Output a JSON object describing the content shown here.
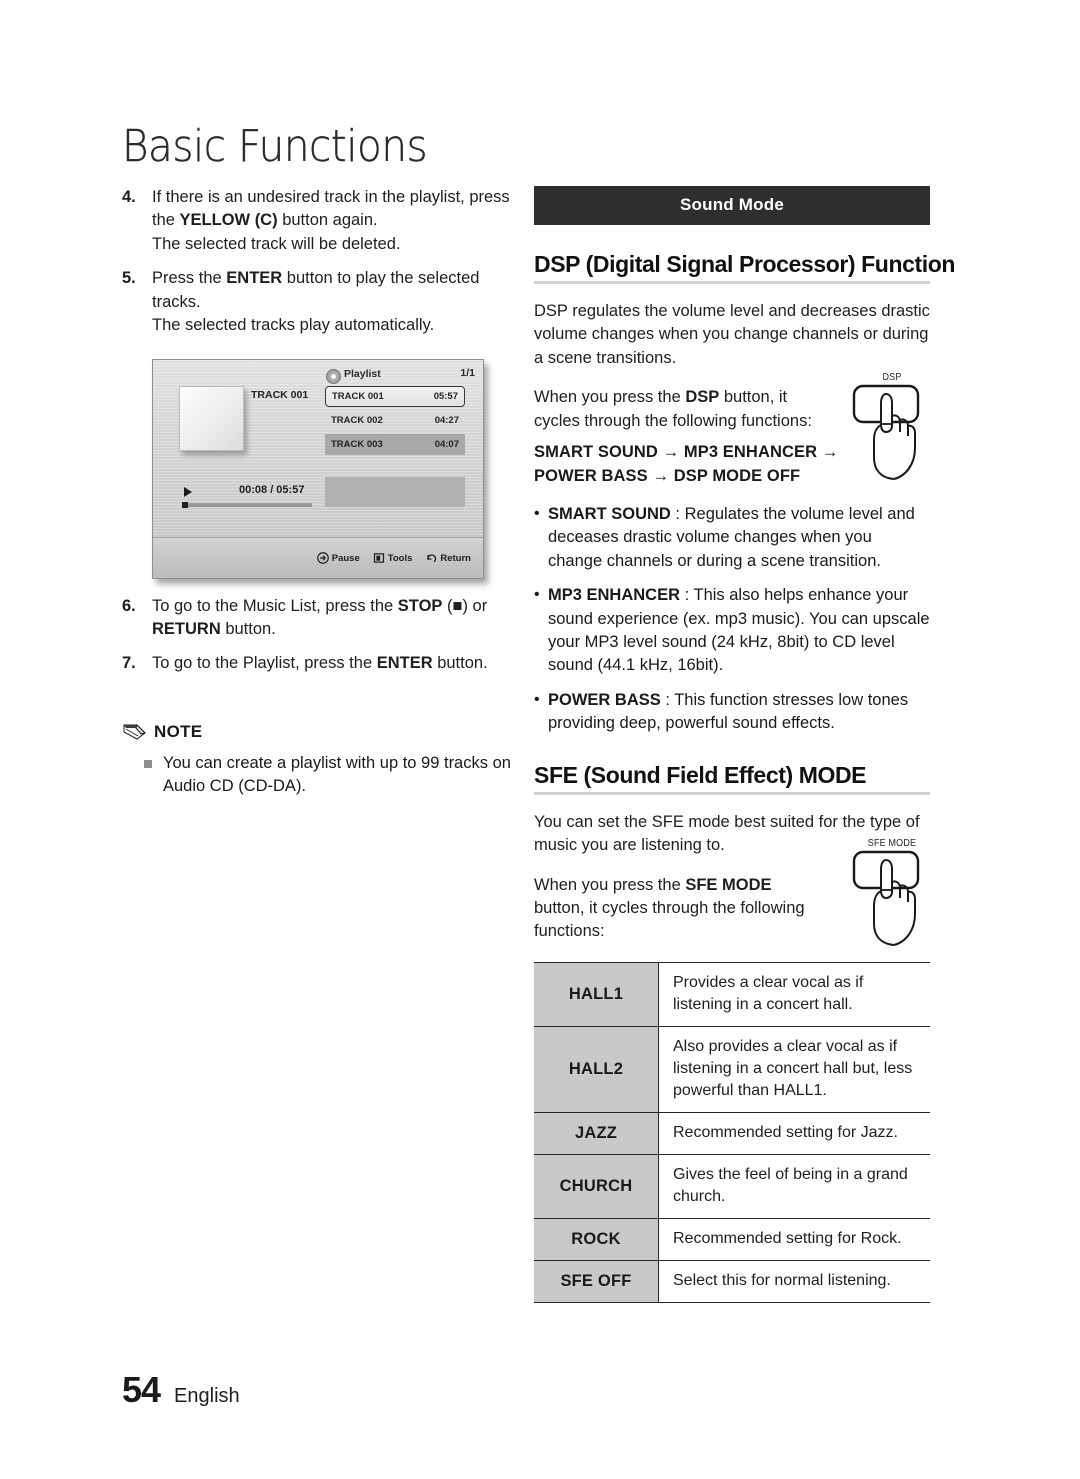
{
  "chapter": {
    "title": "Basic Functions"
  },
  "left_column": {
    "steps": [
      {
        "num": "4.",
        "parts": [
          {
            "t": "If there is an undesired track in the playlist, press the ",
            "b": false
          },
          {
            "t": "YELLOW (C)",
            "b": true
          },
          {
            "t": " button again.",
            "b": false
          },
          {
            "t": "BR",
            "b": false
          },
          {
            "t": "The selected track will be deleted.",
            "b": false
          }
        ]
      },
      {
        "num": "5.",
        "parts": [
          {
            "t": "Press the ",
            "b": false
          },
          {
            "t": "ENTER",
            "b": true
          },
          {
            "t": " button to play the selected tracks.",
            "b": false
          },
          {
            "t": "BR",
            "b": false
          },
          {
            "t": "The selected tracks play automatically.",
            "b": false
          }
        ]
      },
      {
        "num": "6.",
        "parts": [
          {
            "t": "To go to the Music List, press the ",
            "b": false
          },
          {
            "t": "STOP",
            "b": true
          },
          {
            "t": " (■) or ",
            "b": false
          },
          {
            "t": "RETURN",
            "b": true
          },
          {
            "t": " button.",
            "b": false
          }
        ]
      },
      {
        "num": "7.",
        "parts": [
          {
            "t": "To go to the Playlist, press the ",
            "b": false
          },
          {
            "t": "ENTER",
            "b": true
          },
          {
            "t": " button.",
            "b": false
          }
        ]
      }
    ],
    "note": {
      "title": "NOTE",
      "items": [
        "You can create a playlist with up to 99 tracks on Audio CD (CD-DA)."
      ]
    }
  },
  "screenshot": {
    "title": "Playlist",
    "page_indicator": "1/1",
    "now_playing_track": "TRACK 001",
    "time": "00:08 / 05:57",
    "tracks": [
      {
        "name": "TRACK 001",
        "duration": "05:57",
        "state": "selected"
      },
      {
        "name": "TRACK 002",
        "duration": "04:27",
        "state": "plain"
      },
      {
        "name": "TRACK 003",
        "duration": "04:07",
        "state": "highlighted"
      }
    ],
    "footer_buttons": [
      {
        "label": "Pause",
        "icon": "enter-button-icon"
      },
      {
        "label": "Tools",
        "icon": "tools-icon"
      },
      {
        "label": "Return",
        "icon": "return-arrow-icon"
      }
    ]
  },
  "right_column": {
    "banner": "Sound Mode",
    "dsp": {
      "heading": "DSP (Digital Signal Processor) Function",
      "intro": "DSP regulates the volume level and decreases drastic volume changes when you change channels or during a scene transitions.",
      "press_intro_parts": [
        {
          "t": "When you press the ",
          "b": false
        },
        {
          "t": "DSP",
          "b": true
        },
        {
          "t": " button, it cycles through the following functions:",
          "b": false
        }
      ],
      "cycle_line_1": "SMART SOUND  → MP3 ENHANCER →",
      "cycle_line_2": "POWER BASS  →  DSP MODE OFF",
      "button_caption": "DSP",
      "bullets": [
        {
          "term": "SMART SOUND",
          "desc": " : Regulates the volume level and deceases drastic volume changes when you change channels or during a scene transition."
        },
        {
          "term": "MP3 ENHANCER",
          "desc": " : This also helps enhance your sound experience (ex. mp3 music). You can upscale your MP3 level sound (24 kHz, 8bit) to CD level sound (44.1 kHz, 16bit)."
        },
        {
          "term": "POWER BASS",
          "desc": " : This function stresses low tones providing deep, powerful sound effects."
        }
      ]
    },
    "sfe": {
      "heading": "SFE (Sound Field Effect) MODE",
      "intro": "You can set the SFE mode best suited for the type of music you are listening to.",
      "press_intro_parts": [
        {
          "t": "When you press the ",
          "b": false
        },
        {
          "t": "SFE MODE",
          "b": true
        },
        {
          "t": " button, it cycles through the following functions:",
          "b": false
        }
      ],
      "button_caption": "SFE MODE",
      "table": {
        "rows": [
          {
            "mode": "HALL1",
            "desc": "Provides a clear vocal as if listening in a concert hall."
          },
          {
            "mode": "HALL2",
            "desc": "Also provides a clear vocal as if listening in a concert hall but, less powerful than HALL1."
          },
          {
            "mode": "JAZZ",
            "desc": "Recommended setting for Jazz."
          },
          {
            "mode": "CHURCH",
            "desc": "Gives the feel of being in a grand church."
          },
          {
            "mode": "ROCK",
            "desc": "Recommended setting for Rock."
          },
          {
            "mode": "SFE OFF",
            "desc": "Select this for normal listening."
          }
        ]
      }
    }
  },
  "footer": {
    "page_number": "54",
    "language": "English"
  },
  "colors": {
    "banner_bg": "#2e2e2e",
    "table_mode_bg": "#c9c9c9",
    "rule": "#d2d2d2"
  }
}
